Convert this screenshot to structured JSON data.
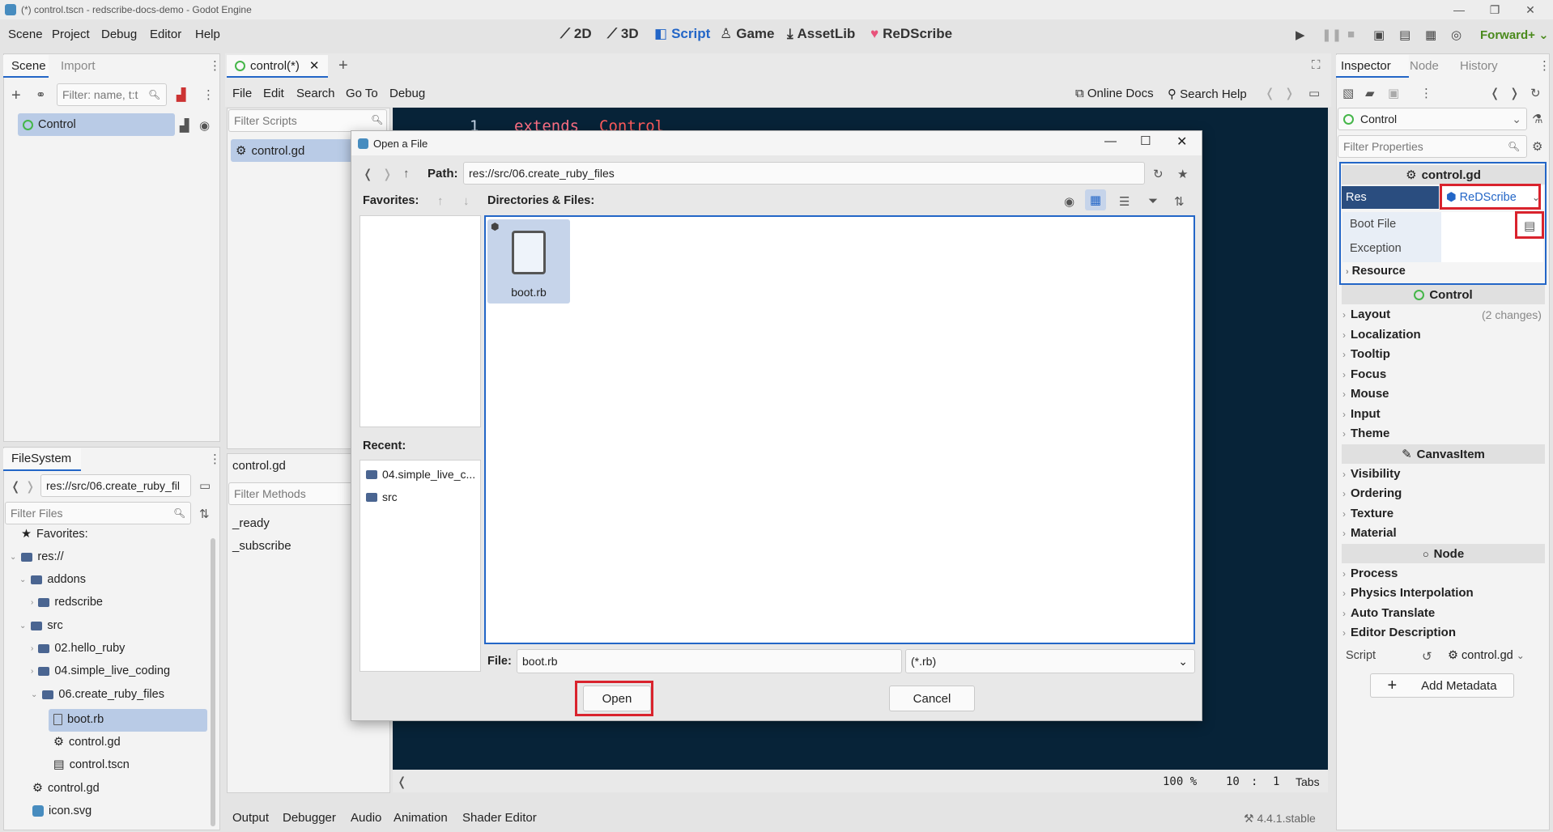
{
  "window": {
    "title": "(*) control.tscn - redscribe-docs-demo - Godot Engine",
    "minimize_glyph": "—",
    "maximize_glyph": "❐",
    "close_glyph": "✕"
  },
  "menubar": {
    "items": [
      "Scene",
      "Project",
      "Debug",
      "Editor",
      "Help"
    ],
    "workspaces": [
      {
        "label": "2D",
        "icon": "⟋"
      },
      {
        "label": "3D",
        "icon": "⟋"
      },
      {
        "label": "Script",
        "icon": "◧"
      },
      {
        "label": "Game",
        "icon": "♙"
      },
      {
        "label": "AssetLib",
        "icon": "⤓"
      },
      {
        "label": "ReDScribe",
        "icon": "♥"
      }
    ],
    "renderer": "Forward+"
  },
  "scene_dock": {
    "tabs": [
      "Scene",
      "Import"
    ],
    "filter_placeholder": "Filter: name, t:t",
    "root_node": "Control"
  },
  "filesystem_dock": {
    "tab": "FileSystem",
    "path": "res://src/06.create_ruby_fil",
    "filter_placeholder": "Filter Files",
    "favorites": "Favorites:",
    "tree": [
      {
        "label": "res://",
        "kind": "folder"
      },
      {
        "label": "addons",
        "kind": "folder"
      },
      {
        "label": "redscribe",
        "kind": "folder"
      },
      {
        "label": "src",
        "kind": "folder"
      },
      {
        "label": "02.hello_ruby",
        "kind": "folder"
      },
      {
        "label": "04.simple_live_coding",
        "kind": "folder"
      },
      {
        "label": "06.create_ruby_files",
        "kind": "folder"
      },
      {
        "label": "boot.rb",
        "kind": "file"
      },
      {
        "label": "control.gd",
        "kind": "gear"
      },
      {
        "label": "control.tscn",
        "kind": "clapper"
      },
      {
        "label": "control.gd",
        "kind": "gear"
      },
      {
        "label": "icon.svg",
        "kind": "image"
      }
    ]
  },
  "script_editor": {
    "tab": "control(*)",
    "menus": [
      "File",
      "Edit",
      "Search",
      "Go To",
      "Debug"
    ],
    "online_docs": "Online Docs",
    "search_help": "Search Help",
    "filter_scripts": "Filter Scripts",
    "scripts": [
      "control.gd"
    ],
    "current_script": "control.gd",
    "filter_methods": "Filter Methods",
    "methods": [
      "_ready",
      "_subscribe"
    ],
    "code_line_number": "1",
    "code_keyword": "extends",
    "code_type": "Control",
    "zoom": "100 %",
    "cursor_line": "10",
    "cursor_col": "1",
    "indent": "Tabs"
  },
  "bottom_panel": {
    "tabs": [
      "Output",
      "Debugger",
      "Audio",
      "Animation",
      "Shader Editor"
    ],
    "version": "4.4.1.stable"
  },
  "dialog": {
    "title": "Open a File",
    "path_label": "Path:",
    "path": "res://src/06.create_ruby_files",
    "favorites_label": "Favorites:",
    "dirs_label": "Directories & Files:",
    "recent_label": "Recent:",
    "recent": [
      "04.simple_live_c...",
      "src"
    ],
    "files": [
      {
        "name": "boot.rb"
      }
    ],
    "file_label": "File:",
    "file_value": "boot.rb",
    "filter": "(*.rb)",
    "open_button": "Open",
    "cancel_button": "Cancel"
  },
  "inspector": {
    "tabs": [
      "Inspector",
      "Node",
      "History"
    ],
    "object": "Control",
    "filter_placeholder": "Filter Properties",
    "script_header": "control.gd",
    "res_label": "Res",
    "res_value": "ReDScribe",
    "dropdown_items": [
      "Boot File",
      "Exception",
      "Resource"
    ],
    "control_section": "Control",
    "control_groups": [
      {
        "label": "Layout",
        "note": "(2 changes)"
      },
      {
        "label": "Localization",
        "note": ""
      },
      {
        "label": "Tooltip",
        "note": ""
      },
      {
        "label": "Focus",
        "note": ""
      },
      {
        "label": "Mouse",
        "note": ""
      },
      {
        "label": "Input",
        "note": ""
      },
      {
        "label": "Theme",
        "note": ""
      }
    ],
    "canvas_section": "CanvasItem",
    "canvas_groups": [
      "Visibility",
      "Ordering",
      "Texture",
      "Material"
    ],
    "node_section": "Node",
    "node_groups": [
      "Process",
      "Physics Interpolation",
      "Auto Translate",
      "Editor Description"
    ],
    "script_label": "Script",
    "script_value": "control.gd",
    "add_metadata": "Add Metadata"
  },
  "colors": {
    "accent": "#2366c7",
    "selection": "#b9cbe6",
    "highlight": "#d9232d",
    "code_bg": "#072338"
  }
}
